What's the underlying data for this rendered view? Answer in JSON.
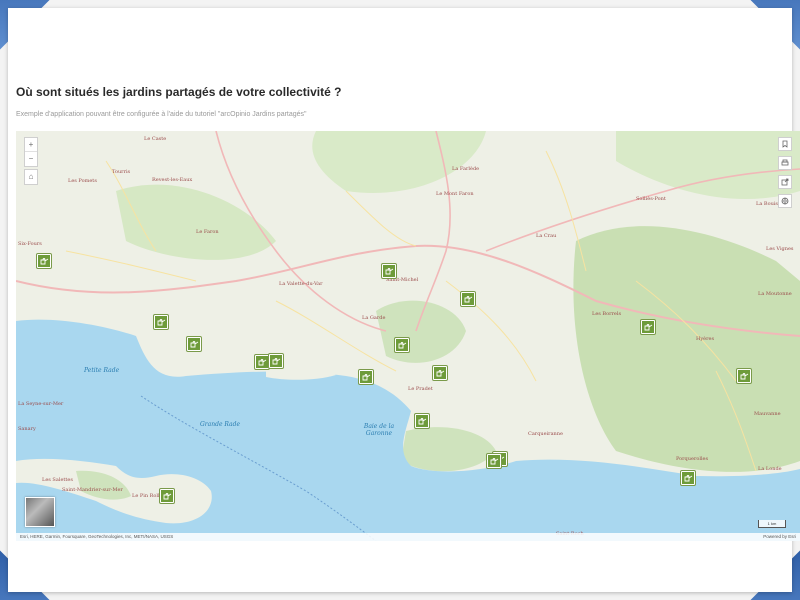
{
  "header": {
    "title": "Où sont situés les jardins partagés de votre collectivité ?",
    "subtitle": "Exemple d'application pouvant être configurée à l'aide du tutoriel \"arcOpinio Jardins partagés\""
  },
  "map": {
    "zoom_in": "+",
    "zoom_out": "−",
    "home": "⌂",
    "attribution": "Esri, HERE, Garmin, Foursquare, GeoTechnologies, Inc, METI/NASA, USGS",
    "powered_by": "Powered by Esri",
    "scale": "1 km",
    "water_labels": [
      "Petite Rade",
      "Grande Rade",
      "Baie de la Garonne"
    ],
    "places": [
      "Le Caste",
      "Les Pomets",
      "Tourris",
      "Revest-les-Eaux",
      "Le Faron",
      "La Farlède",
      "La Crau",
      "La Valette-du-Var",
      "Saint-Michel",
      "La Garde",
      "Le Pradet",
      "Hyères",
      "La Londe",
      "Carqueiranne",
      "Les Salettes",
      "Saint-Mandrier-sur-Mer",
      "Le Pin Rolland",
      "La Seyne-sur-Mer",
      "Six-Fours",
      "Solliès-Pont",
      "Le Mont Faron",
      "Les Borrels",
      "Porquerolles",
      "Saint-Roch",
      "La Moutonne",
      "Les Vignes",
      "La Bouisse",
      "Sanary",
      "Mauvanne"
    ],
    "marker_count": 17
  },
  "colors": {
    "sea": "#a9d7ef",
    "land": "#eef0e6",
    "forest": "#cfe3bd",
    "road_major": "#f1b8b8",
    "road_minor": "#f7e3a1",
    "marker_green": "#6e9b3a",
    "frame_corner": "#3a6ab5"
  }
}
